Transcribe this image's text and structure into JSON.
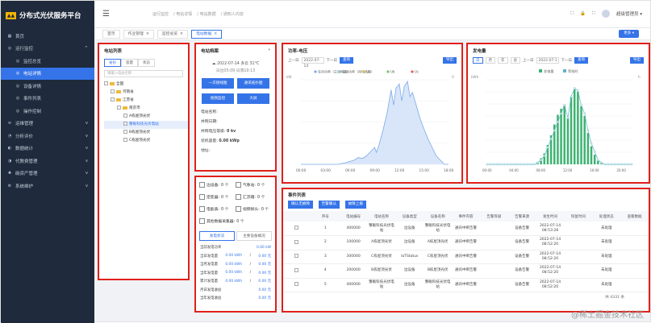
{
  "app": {
    "title": "分布式光伏服务平台",
    "logo_text": "▲▲"
  },
  "sidebar": {
    "items": [
      {
        "label": "首页",
        "icon": "▦"
      },
      {
        "label": "运行监控",
        "icon": "◎",
        "caret": "^"
      },
      {
        "label": "监控总览",
        "icon": "◎"
      },
      {
        "label": "电站详情",
        "icon": "◎"
      },
      {
        "label": "设备详情",
        "icon": "◎"
      },
      {
        "label": "事件列表",
        "icon": "◎"
      },
      {
        "label": "操作控制",
        "icon": "◎"
      },
      {
        "label": "运维管理",
        "icon": "≡",
        "caret": "v"
      },
      {
        "label": "分析评价",
        "icon": "◔",
        "caret": "v"
      },
      {
        "label": "数据统计",
        "icon": "◐",
        "caret": "v"
      },
      {
        "label": "代教费管理",
        "icon": "◑",
        "caret": "v"
      },
      {
        "label": "碳资产管理",
        "icon": "♣",
        "caret": "v"
      },
      {
        "label": "系统维护",
        "icon": "⚙",
        "caret": "v"
      }
    ]
  },
  "header": {
    "menu_icon": "☰",
    "breadcrumb": [
      "运行监控",
      "/ 电站详情",
      "/ 电站数据",
      "/ 通知人内容"
    ],
    "user_name": "超级管理员 ▾",
    "icons": [
      "⛶",
      "🔒",
      "⛶"
    ]
  },
  "tabs": {
    "items": [
      {
        "label": "首页"
      },
      {
        "label": "作业管理",
        "close": "×"
      },
      {
        "label": "监控总览",
        "close": "×"
      },
      {
        "label": "电站数据",
        "close": "×"
      }
    ],
    "more": "更多 ▾"
  },
  "station_list": {
    "title": "电站列表",
    "filters": [
      "省份",
      "容量",
      "状态"
    ],
    "search_placeholder": "请输入电站名称",
    "tree": [
      "全国",
      "河南省",
      "江苏省",
      "南京市",
      "A栋屋顶光伏",
      "蟹蛎科技光伏电站",
      "B栋屋顶光伏",
      "C栋屋顶光伏"
    ]
  },
  "archive": {
    "title": "电站档案",
    "chevron": "›",
    "date": "2022-07-14",
    "weather": "多云 31°C",
    "sunrise": "日出05:09",
    "sunset": "日落19:13",
    "buttons": [
      "一次接线图",
      "通讯拓扑图",
      "视频监控",
      "大屏"
    ],
    "fields": [
      {
        "label": "电站名称:",
        "value": ""
      },
      {
        "label": "并网日期:",
        "value": ""
      },
      {
        "label": "并网电压等级:",
        "value": "0 kv"
      },
      {
        "label": "装机容量:",
        "value": "0.00 kWp"
      },
      {
        "label": "地址:",
        "value": ""
      }
    ]
  },
  "devices": {
    "items": [
      {
        "label": "边设备:",
        "value": "0 个"
      },
      {
        "label": "气象站:",
        "value": "0 个"
      },
      {
        "label": "逆变器:",
        "value": "0 个"
      },
      {
        "label": "汇流箱:",
        "value": "0 个"
      },
      {
        "label": "电能表:",
        "value": "0 个"
      },
      {
        "label": "视频探头:",
        "value": "0 个"
      },
      {
        "label": "其他数据采集器:",
        "value": "0 个"
      }
    ],
    "subtabs": [
      "发电状况",
      "主要设备概况"
    ],
    "stats": [
      {
        "label": "当前发电功率",
        "value": "0.00 kW"
      },
      {
        "label": "当日发电量",
        "a": "0.00 kWh",
        "b": "0.00 元"
      },
      {
        "label": "当月发电量",
        "a": "0.00 kWh",
        "b": "0.00 元"
      },
      {
        "label": "当年发电量",
        "a": "0.00 kWh",
        "b": "0.00 元"
      },
      {
        "label": "累计发电量",
        "a": "0.00 kWh",
        "b": "0.00 元"
      },
      {
        "label": "月日发电收益",
        "value": "0.00 元"
      },
      {
        "label": "当年发电收益",
        "value": "0.00 元"
      }
    ]
  },
  "power_chart": {
    "title": "功率-电压",
    "prev": "上一日",
    "date": "2022-07-14",
    "next": "下一日",
    "query": "查询",
    "export": "导出",
    "legend": [
      "有功功率（总发电量）",
      "有功功率（用电负荷）",
      "Ua",
      "Ub",
      "Uc"
    ],
    "y_unit_left": "kW",
    "y_unit_right": "V"
  },
  "energy_chart": {
    "title": "发电量",
    "ranges": [
      "日",
      "月",
      "年",
      "总"
    ],
    "prev": "上一日",
    "date": "2022-07-1",
    "next": "下一日",
    "query": "查询",
    "export": "导出",
    "legend": [
      "发电量",
      "等效时"
    ],
    "y_unit_left": "kWh",
    "y_unit_right": "h"
  },
  "chart_data": [
    {
      "type": "line",
      "title": "功率-电压",
      "x": [
        "00:00",
        "03:00",
        "06:00",
        "09:00",
        "12:00",
        "15:00",
        "18:00"
      ],
      "ylabel": "kW",
      "series": [
        {
          "name": "有功功率（总发电量）",
          "color": "#7aa9e8",
          "points": [
            [
              0,
              0
            ],
            [
              4.5,
              0
            ],
            [
              5.5,
              2
            ],
            [
              6.5,
              5
            ],
            [
              7,
              8
            ],
            [
              7.5,
              7
            ],
            [
              8,
              10
            ],
            [
              8.5,
              15
            ],
            [
              9,
              20
            ],
            [
              9.2,
              14
            ],
            [
              9.5,
              22
            ],
            [
              10,
              40
            ],
            [
              10.5,
              60
            ],
            [
              11,
              88
            ],
            [
              11.3,
              70
            ],
            [
              11.6,
              90
            ],
            [
              12,
              95
            ],
            [
              12.3,
              75
            ],
            [
              12.6,
              92
            ],
            [
              13,
              98
            ],
            [
              13.3,
              80
            ],
            [
              13.6,
              85
            ],
            [
              14,
              72
            ],
            [
              14.5,
              55
            ],
            [
              15,
              42
            ],
            [
              15.5,
              30
            ],
            [
              16,
              20
            ],
            [
              16.5,
              10
            ],
            [
              17,
              5
            ],
            [
              17.5,
              0
            ],
            [
              18,
              0
            ]
          ]
        }
      ],
      "ylim": [
        0,
        100
      ],
      "xlim": [
        0,
        18
      ]
    },
    {
      "type": "bar",
      "title": "发电量",
      "categories": [
        "00:00",
        "00:30",
        "01:00",
        "01:30",
        "02:00",
        "02:30",
        "03:00",
        "03:30",
        "04:00",
        "04:30",
        "05:00",
        "05:30",
        "06:00",
        "06:30",
        "07:00",
        "07:30",
        "08:00",
        "08:30",
        "09:00",
        "09:30",
        "10:00",
        "10:30",
        "11:00",
        "11:30",
        "12:00",
        "12:30",
        "13:00",
        "13:30",
        "14:00",
        "14:30",
        "15:00",
        "15:30",
        "16:00",
        "16:30",
        "17:00",
        "17:30",
        "18:00",
        "18:30",
        "19:00",
        "19:30",
        "20:00",
        "20:30",
        "21:00",
        "21:30"
      ],
      "series": [
        {
          "name": "发电量",
          "color": "#3cb371",
          "axis": "left",
          "values": [
            0,
            0,
            0,
            0,
            0,
            0,
            0,
            0,
            0,
            0,
            0,
            0,
            0,
            0,
            0,
            2,
            5,
            9,
            16,
            24,
            33,
            41,
            46,
            49,
            38,
            56,
            62,
            60,
            48,
            40,
            26,
            15,
            8,
            3,
            1,
            0,
            0,
            0,
            0,
            0,
            0,
            0,
            0,
            0
          ]
        },
        {
          "name": "等效时",
          "color": "#5fb4c9",
          "axis": "right",
          "values": [
            0,
            0,
            0,
            0,
            0,
            0,
            0,
            0,
            0,
            0,
            0,
            0,
            0,
            0,
            0,
            0.002,
            0.005,
            0.01,
            0.02,
            0.03,
            0.04,
            0.05,
            0.06,
            0.07,
            0.055,
            0.08,
            0.09,
            0.087,
            0.07,
            0.06,
            0.04,
            0.025,
            0.015,
            0.005,
            0.002,
            0,
            0,
            0,
            0,
            0,
            0,
            0,
            0,
            0
          ]
        }
      ],
      "ylim_left": [
        0,
        70
      ],
      "ylim_right": [
        0,
        0.1
      ]
    }
  ],
  "events": {
    "title": "事件列表",
    "buttons": [
      "确认无故障",
      "告警确认",
      "故障上报"
    ],
    "columns": [
      "",
      "序号",
      "电站编号",
      "电站名称",
      "设备类型",
      "设备名称",
      "事件内容",
      "告警等级",
      "告警来源",
      "发生时间",
      "恢复时间",
      "处理状态",
      "查看数据"
    ],
    "rows": [
      [
        "",
        "1",
        "400000",
        "蟹蛎科技光伏电站",
        "边设备",
        "蟹蛎科技光伏电站",
        "通讯中断告警",
        "",
        "设备告警",
        "2022-07-14 08:53:28",
        "",
        "未处理",
        ""
      ],
      [
        "",
        "2",
        "100000",
        "A栋屋顶光伏",
        "边设备",
        "A栋屋顶光伏",
        "通讯中断告警",
        "",
        "设备告警",
        "2022-07-14 08:52:20",
        "",
        "未处理",
        ""
      ],
      [
        "",
        "3",
        "300000",
        "C栋屋顶光伏",
        "IoTStatus",
        "C栋屋顶光伏",
        "通讯中断告警",
        "",
        "设备告警",
        "2022-07-14 08:52:20",
        "",
        "未处理",
        ""
      ],
      [
        "",
        "4",
        "200000",
        "B栋屋顶光伏",
        "边设备",
        "B栋屋顶光伏",
        "通讯中断告警",
        "",
        "设备告警",
        "2022-07-14 08:52:20",
        "",
        "未处理",
        ""
      ],
      [
        "",
        "5",
        "400000",
        "蟹蛎科技光伏电站",
        "边设备",
        "蟹蛎科技光伏电站",
        "通讯中断告警",
        "",
        "设备告警",
        "2022-07-14 08:52:20",
        "",
        "未处理",
        ""
      ]
    ],
    "pager": "共 4331 条"
  },
  "watermark": "@稀土掘金技术社区"
}
